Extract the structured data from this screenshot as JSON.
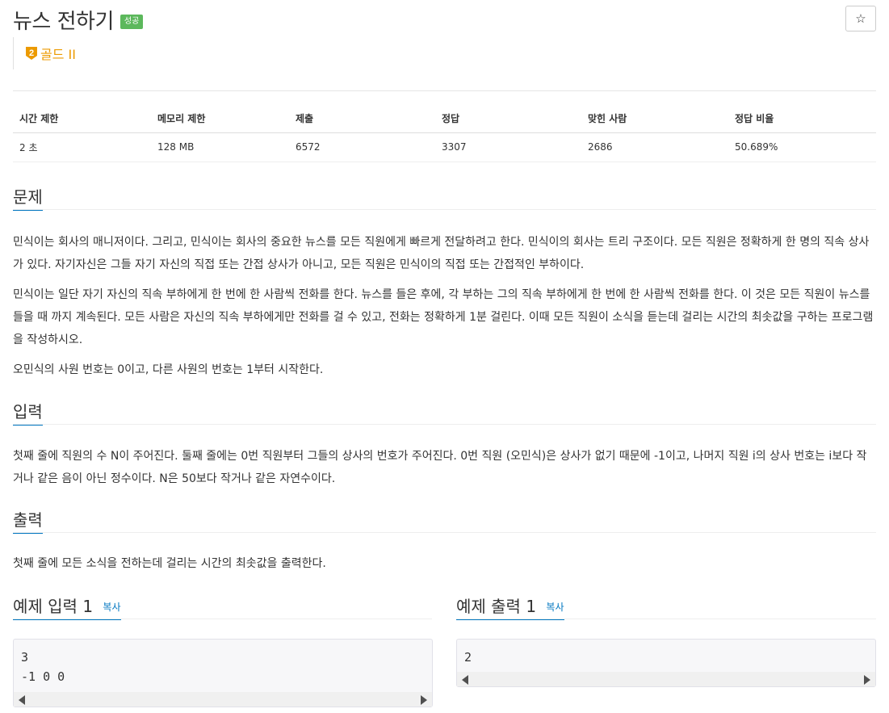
{
  "header": {
    "title": "뉴스 전하기",
    "result_badge": "성공",
    "tier_number": "2",
    "tier_label": "골드 II",
    "star": "☆"
  },
  "info_table": {
    "headers": [
      "시간 제한",
      "메모리 제한",
      "제출",
      "정답",
      "맞힌 사람",
      "정답 비율"
    ],
    "values": [
      "2 초",
      "128 MB",
      "6572",
      "3307",
      "2686",
      "50.689%"
    ]
  },
  "sections": {
    "problem": {
      "title": "문제",
      "p1": "민식이는 회사의 매니저이다. 그리고, 민식이는 회사의 중요한 뉴스를 모든 직원에게 빠르게 전달하려고 한다. 민식이의 회사는 트리 구조이다. 모든 직원은 정확하게 한 명의 직속 상사가 있다. 자기자신은 그들 자기 자신의 직접 또는 간접 상사가 아니고, 모든 직원은 민식이의 직접 또는 간접적인 부하이다.",
      "p2": "민식이는 일단 자기 자신의 직속 부하에게 한 번에 한 사람씩 전화를 한다. 뉴스를 들은 후에, 각 부하는 그의 직속 부하에게 한 번에 한 사람씩 전화를 한다. 이 것은 모든 직원이 뉴스를 들을 때 까지 계속된다. 모든 사람은 자신의 직속 부하에게만 전화를 걸 수 있고, 전화는 정확하게 1분 걸린다. 이때 모든 직원이 소식을 듣는데 걸리는 시간의 최솟값을 구하는 프로그램을 작성하시오.",
      "p3": "오민식의 사원 번호는 0이고, 다른 사원의 번호는 1부터 시작한다."
    },
    "input": {
      "title": "입력",
      "p1": "첫째 줄에 직원의 수 N이 주어진다. 둘째 줄에는 0번 직원부터 그들의 상사의 번호가 주어진다. 0번 직원 (오민식)은 상사가 없기 때문에 -1이고, 나머지 직원 i의 상사 번호는 i보다 작거나 같은 음이 아닌 정수이다. N은 50보다 작거나 같은 자연수이다."
    },
    "output": {
      "title": "출력",
      "p1": "첫째 줄에 모든 소식을 전하는데 걸리는 시간의 최솟값을 출력한다."
    }
  },
  "samples": {
    "input1": {
      "title": "예제 입력 1",
      "copy": "복사",
      "content": "3\n-1 0 0"
    },
    "output1": {
      "title": "예제 출력 1",
      "copy": "복사",
      "content": "2"
    }
  },
  "colors": {
    "accent": "#0076c0",
    "success": "#5cb85c",
    "gold": "#ec9a00"
  }
}
